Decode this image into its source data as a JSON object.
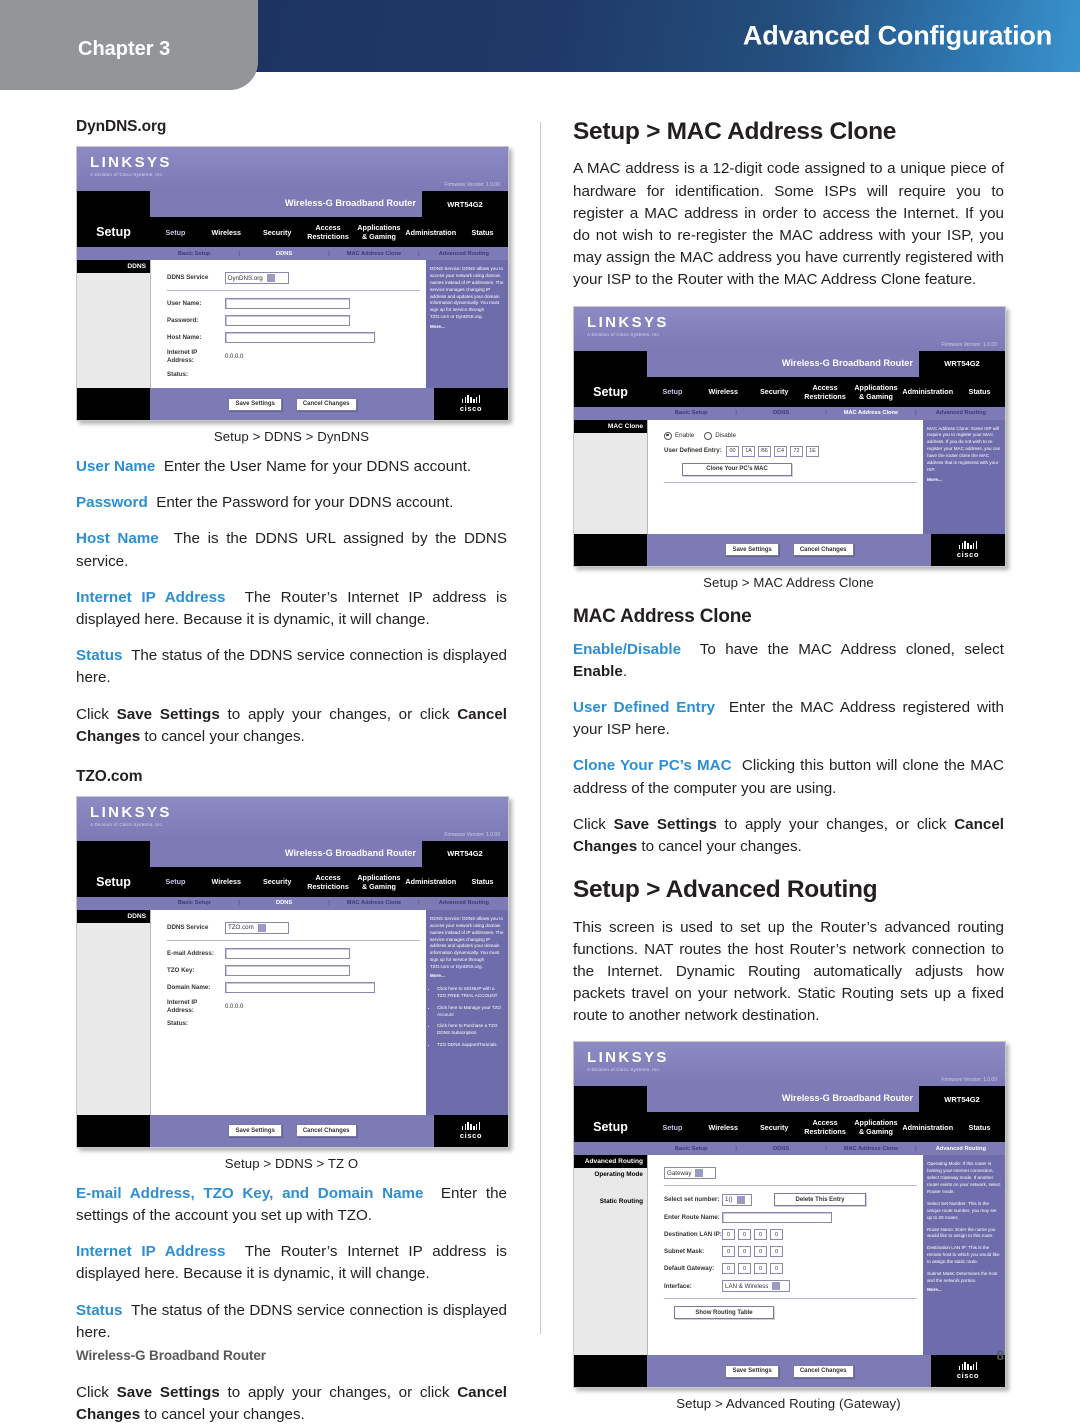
{
  "header": {
    "chapter_label": "Chapter 3",
    "title": "Advanced Configuration",
    "accent_dark": "#1d3461",
    "accent_light": "#3a93cd",
    "tab_gray": "#939598"
  },
  "footer": {
    "product": "Wireless-G Broadband Router",
    "page_number": "8"
  },
  "term_color": "#2c8fd4",
  "left_column": {
    "dyndns_heading": "DynDNS.org",
    "dyndns_caption": "Setup > DDNS > DynDNS",
    "entries": [
      {
        "term": "User Name",
        "text": "Enter the User Name for your DDNS account."
      },
      {
        "term": "Password",
        "text": "Enter the Password for your DDNS account."
      },
      {
        "term": "Host Name",
        "text": "The is the DDNS URL assigned by the DDNS service."
      },
      {
        "term": "Internet IP Address",
        "text": "The Router’s Internet IP address is displayed here. Because it is dynamic, it will change."
      },
      {
        "term": "Status",
        "text": "The status of the DDNS service connection is displayed here."
      }
    ],
    "save_note_pre": "Click ",
    "save_note_b1": "Save Settings",
    "save_note_mid": " to apply your changes, or click ",
    "save_note_b2": "Cancel Changes",
    "save_note_post": " to cancel your changes.",
    "tzo_heading": "TZO.com",
    "tzo_caption": "Setup  > DDNS > TZ O",
    "tzo_entries": [
      {
        "term": "E-mail Address, TZO Key, and Domain Name",
        "text": "Enter the settings of the account you set up with TZO."
      },
      {
        "term": "Internet IP Address",
        "text": "The Router’s Internet IP address is displayed here. Because it is dynamic, it will change."
      },
      {
        "term": "Status",
        "text": "The status of the DDNS service connection is displayed here."
      }
    ]
  },
  "right_column": {
    "mac_heading": "Setup > MAC Address Clone",
    "mac_intro": "A MAC address is a 12-digit code assigned to a unique piece of hardware for identification. Some ISPs will require you to register a MAC address in order to access the Internet. If you do not wish to re-register the MAC address with your ISP, you may assign the MAC address you have currently registered with your ISP to the Router with the MAC Address Clone feature.",
    "mac_caption": "Setup > MAC Address Clone",
    "mac_subheading": "MAC Address Clone",
    "mac_entries": [
      {
        "term": "Enable/Disable",
        "text": "To have the MAC Address cloned, select ",
        "bold_tail": "Enable",
        "tail": "."
      },
      {
        "term": "User Defined Entry",
        "text": "Enter the MAC Address registered with your ISP here."
      },
      {
        "term": "Clone Your PC’s MAC",
        "text": "Clicking this button will clone the MAC address of the computer you are using."
      }
    ],
    "routing_heading": "Setup > Advanced Routing",
    "routing_intro": "This screen is used to set up the Router’s advanced routing functions. NAT routes the host Router’s network connection to the Internet. Dynamic Routing automatically adjusts how packets travel on your network. Static Routing sets up a fixed route to another network destination.",
    "routing_caption": "Setup > Advanced Routing (Gateway)"
  },
  "router_ui": {
    "brand": "LINKSYS",
    "brand_sub": "A Division of Cisco Systems, Inc.",
    "firmware": "Firmware Version: 1.0.00",
    "model_name": "Wireless-G Broadband Router",
    "model_code": "WRT54G2",
    "setup_label": "Setup",
    "tabs": [
      "Setup",
      "Wireless",
      "Security",
      "Access Restrictions",
      "Applications & Gaming",
      "Administration",
      "Status"
    ],
    "subtabs": [
      "Basic Setup",
      "DDNS",
      "MAC Address Clone",
      "Advanced Routing"
    ],
    "save_button": "Save Settings",
    "cancel_button": "Cancel Changes",
    "cisco_word": "cisco"
  },
  "screen_dyndns": {
    "side_head": "DDNS",
    "service_label": "DDNS Service",
    "service_value": "DynDNS.org",
    "fields": [
      "User Name:",
      "Password:",
      "Host Name:"
    ],
    "ip_label": "Internet IP Address:",
    "ip_value": "0.0.0.0",
    "status_label": "Status:",
    "help_text": "DDNS Service: DDNS allows you to access your network using domain names instead of IP addresses. The service manages changing IP address and updates your domain information dynamically. You must sign up for service through TZO.com or DynDNS.org.",
    "help_more": "More..."
  },
  "screen_tzo": {
    "side_head": "DDNS",
    "service_label": "DDNS Service",
    "service_value": "TZO.com",
    "fields": [
      "E-mail Address:",
      "TZO Key:",
      "Domain Name:"
    ],
    "ip_label": "Internet IP Address:",
    "ip_value": "0.0.0.0",
    "status_label": "Status:",
    "help_text": "DDNS Service: DDNS allows you to access your network using domain names instead of IP addresses. The service manages changing IP address and updates your domain information dynamically. You must sign up for service through TZO.com or DynDNS.org.",
    "help_more": "More...",
    "help_bullets": [
      "Click here to SIGNUP with a TZO FREE TRIAL ACCOUNT",
      "Click here to Manage your TZO Account",
      "Click here to Purchase a TZO DDNS Subscription",
      "TZO DDNS Support/Tutorials"
    ]
  },
  "screen_mac": {
    "side_head": "MAC Clone",
    "enable_label": "Enable",
    "disable_label": "Disable",
    "entry_label": "User Defined Entry:",
    "octets": [
      "00",
      "1A",
      "B6",
      "C4",
      "72",
      "1E"
    ],
    "clone_button": "Clone Your PC’s MAC",
    "help_text": "MAC Address Clone: Some ISP will require you to register your MAC address. If you do not wish to re-register your MAC address, you can have the router clone the MAC address that is registered with your ISP.",
    "help_more": "More..."
  },
  "screen_routing": {
    "side_head": "Advanced Routing",
    "side_items": [
      "Operating Mode",
      "Static Routing"
    ],
    "mode_value": "Gateway",
    "route_num_label": "Select set number:",
    "route_num_value": "1()",
    "delete_button": "Delete This Entry",
    "route_name_label": "Enter Route Name:",
    "dest_label": "Destination LAN IP:",
    "subnet_label": "Subnet Mask:",
    "gateway_label": "Default Gateway:",
    "interface_label": "Interface:",
    "interface_value": "LAN & Wireless",
    "octet_value": "0",
    "show_table_button": "Show Routing Table",
    "help_text": "Operating Mode: If this router is hosting your Internet connection, select Gateway mode. If another router exists on your network, select Router mode.",
    "help_paras": [
      "Select Set Number: This is the unique route number, you may set up to 20 routes.",
      "Route Name: Enter the name you would like to assign to this route.",
      "Destination LAN IP: This is the remote host to which you would like to assign the static route.",
      "Subnet Mask: Determines the host and the network portion."
    ],
    "help_more": "More..."
  }
}
